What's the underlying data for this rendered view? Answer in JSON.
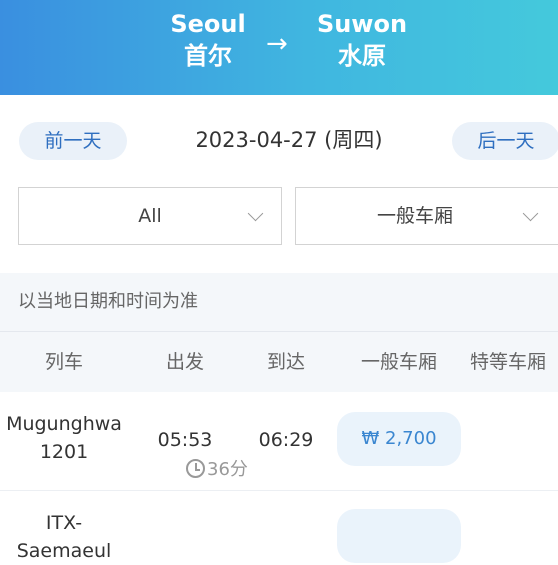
{
  "header": {
    "from_en": "Seoul",
    "from_zh": "首尔",
    "to_en": "Suwon",
    "to_zh": "水原",
    "arrow": "→"
  },
  "date_nav": {
    "prev_label": "前一天",
    "date": "2023-04-27 (周四)",
    "next_label": "后一天"
  },
  "filters": {
    "train_type": "All",
    "car_class": "一般车厢"
  },
  "note": "以当地日期和时间为准",
  "table": {
    "headers": [
      "列车",
      "出发",
      "到达",
      "一般车厢",
      "特等车厢"
    ],
    "rows": [
      {
        "train_line1": "Mugunghwa",
        "train_line2": "1201",
        "departure": "05:53",
        "arrival": "06:29",
        "duration": "36分",
        "standard_price": "₩ 2,700",
        "first_class_price": ""
      },
      {
        "train_line1": "ITX-Saemaeul",
        "train_line2": "",
        "departure": "",
        "arrival": "",
        "duration": "",
        "standard_price": "",
        "first_class_price": ""
      }
    ]
  },
  "colors": {
    "header_gradient_start": "#3a8fe0",
    "header_gradient_end": "#44c9dc",
    "accent_blue": "#2f6fc0",
    "price_bg": "#eaf3fb"
  }
}
